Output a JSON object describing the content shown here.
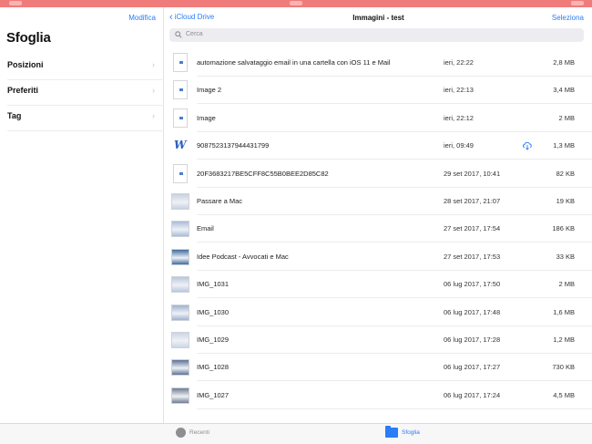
{
  "sidebar": {
    "edit_label": "Modifica",
    "title": "Sfoglia",
    "items": [
      {
        "label": "Posizioni"
      },
      {
        "label": "Preferiti"
      },
      {
        "label": "Tag"
      }
    ]
  },
  "nav": {
    "back_label": "iCloud Drive",
    "title": "Immagini - test",
    "select_label": "Seleziona"
  },
  "search": {
    "placeholder": "Cerca"
  },
  "files": [
    {
      "name": "automazione salvataggio email in una cartella con iOS 11 e Mail",
      "date": "ieri, 22:22",
      "size": "2,8 MB",
      "icon": "document-icon"
    },
    {
      "name": "Image 2",
      "date": "ieri, 22:13",
      "size": "3,4 MB",
      "icon": "document-icon"
    },
    {
      "name": "Image",
      "date": "ieri, 22:12",
      "size": "2 MB",
      "icon": "document-icon"
    },
    {
      "name": "9087523137944431799",
      "date": "ieri, 09:49",
      "size": "1,3 MB",
      "icon": "word-icon",
      "cloud": "cloud-download-icon"
    },
    {
      "name": "20F3683217BE5CFF8C55B0BEE2D85C82",
      "date": "29 set 2017, 10:41",
      "size": "82 KB",
      "icon": "document-icon"
    },
    {
      "name": "Passare a Mac",
      "date": "28 set 2017, 21:07",
      "size": "19 KB",
      "icon": "image-thumbnail"
    },
    {
      "name": "Email",
      "date": "27 set 2017, 17:54",
      "size": "186 KB",
      "icon": "image-thumbnail"
    },
    {
      "name": "Idee Podcast - Avvocati e Mac",
      "date": "27 set 2017, 17:53",
      "size": "33 KB",
      "icon": "image-thumbnail"
    },
    {
      "name": "IMG_1031",
      "date": "06 lug 2017, 17:50",
      "size": "2 MB",
      "icon": "image-thumbnail"
    },
    {
      "name": "IMG_1030",
      "date": "06 lug 2017, 17:48",
      "size": "1,6 MB",
      "icon": "image-thumbnail"
    },
    {
      "name": "IMG_1029",
      "date": "06 lug 2017, 17:28",
      "size": "1,2 MB",
      "icon": "image-thumbnail"
    },
    {
      "name": "IMG_1028",
      "date": "06 lug 2017, 17:27",
      "size": "730 KB",
      "icon": "image-thumbnail"
    },
    {
      "name": "IMG_1027",
      "date": "06 lug 2017, 17:24",
      "size": "4,5 MB",
      "icon": "image-thumbnail"
    }
  ],
  "tabbar": {
    "recent_label": "Recenti",
    "browse_label": "Sfoglia"
  },
  "colors": {
    "accent": "#2b7cf6",
    "status_bar": "#f07b7b"
  }
}
